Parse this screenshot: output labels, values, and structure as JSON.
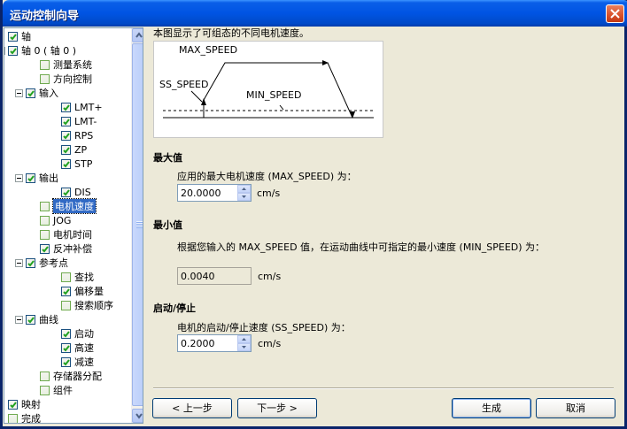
{
  "window": {
    "title": "运动控制向导"
  },
  "tree": {
    "items": [
      {
        "label": "轴",
        "checked": true,
        "expander": false
      },
      {
        "label": "轴 0 ( 轴 0 )",
        "checked": true,
        "expander": true
      },
      {
        "label": "测量系统",
        "checked": false,
        "expander": false
      },
      {
        "label": "方向控制",
        "checked": false,
        "expander": false
      },
      {
        "label": "输入",
        "checked": true,
        "expander": true
      },
      {
        "label": "LMT+",
        "checked": true,
        "expander": false
      },
      {
        "label": "LMT-",
        "checked": true,
        "expander": false
      },
      {
        "label": "RPS",
        "checked": true,
        "expander": false
      },
      {
        "label": "ZP",
        "checked": true,
        "expander": false
      },
      {
        "label": "STP",
        "checked": true,
        "expander": false
      },
      {
        "label": "输出",
        "checked": true,
        "expander": true
      },
      {
        "label": "DIS",
        "checked": true,
        "expander": false
      },
      {
        "label": "电机速度",
        "checked": false,
        "expander": false,
        "selected": true
      },
      {
        "label": "JOG",
        "checked": false,
        "expander": false
      },
      {
        "label": "电机时间",
        "checked": false,
        "expander": false
      },
      {
        "label": "反冲补偿",
        "checked": true,
        "expander": false
      },
      {
        "label": "参考点",
        "checked": true,
        "expander": true
      },
      {
        "label": "查找",
        "checked": false,
        "expander": false
      },
      {
        "label": "偏移量",
        "checked": true,
        "expander": false
      },
      {
        "label": "搜索顺序",
        "checked": false,
        "expander": false
      },
      {
        "label": "曲线",
        "checked": true,
        "expander": true
      },
      {
        "label": "启动",
        "checked": true,
        "expander": false
      },
      {
        "label": "高速",
        "checked": true,
        "expander": false
      },
      {
        "label": "减速",
        "checked": true,
        "expander": false
      },
      {
        "label": "存储器分配",
        "checked": false,
        "expander": false
      },
      {
        "label": "组件",
        "checked": false,
        "expander": false
      },
      {
        "label": "映射",
        "checked": true,
        "expander": false
      },
      {
        "label": "完成",
        "checked": false,
        "expander": false
      }
    ]
  },
  "main": {
    "hint": "本图显示了可组态的不同电机速度。",
    "diagram": {
      "max_label": "MAX_SPEED",
      "ss_label": "SS_SPEED",
      "min_label": "MIN_SPEED"
    },
    "max": {
      "title": "最大值",
      "desc": "应用的最大电机速度 (MAX_SPEED) 为：",
      "value": "20.0000",
      "unit": "cm/s"
    },
    "min": {
      "title": "最小值",
      "desc": "根据您输入的 MAX_SPEED 值，在运动曲线中可指定的最小速度 (MIN_SPEED) 为：",
      "value": "0.0040",
      "unit": "cm/s"
    },
    "ss": {
      "title": "启动/停止",
      "desc": "电机的启动/停止速度 (SS_SPEED) 为：",
      "value": "0.2000",
      "unit": "cm/s"
    }
  },
  "buttons": {
    "prev": "< 上一步",
    "next": "下一步 >",
    "generate": "生成",
    "cancel": "取消"
  }
}
